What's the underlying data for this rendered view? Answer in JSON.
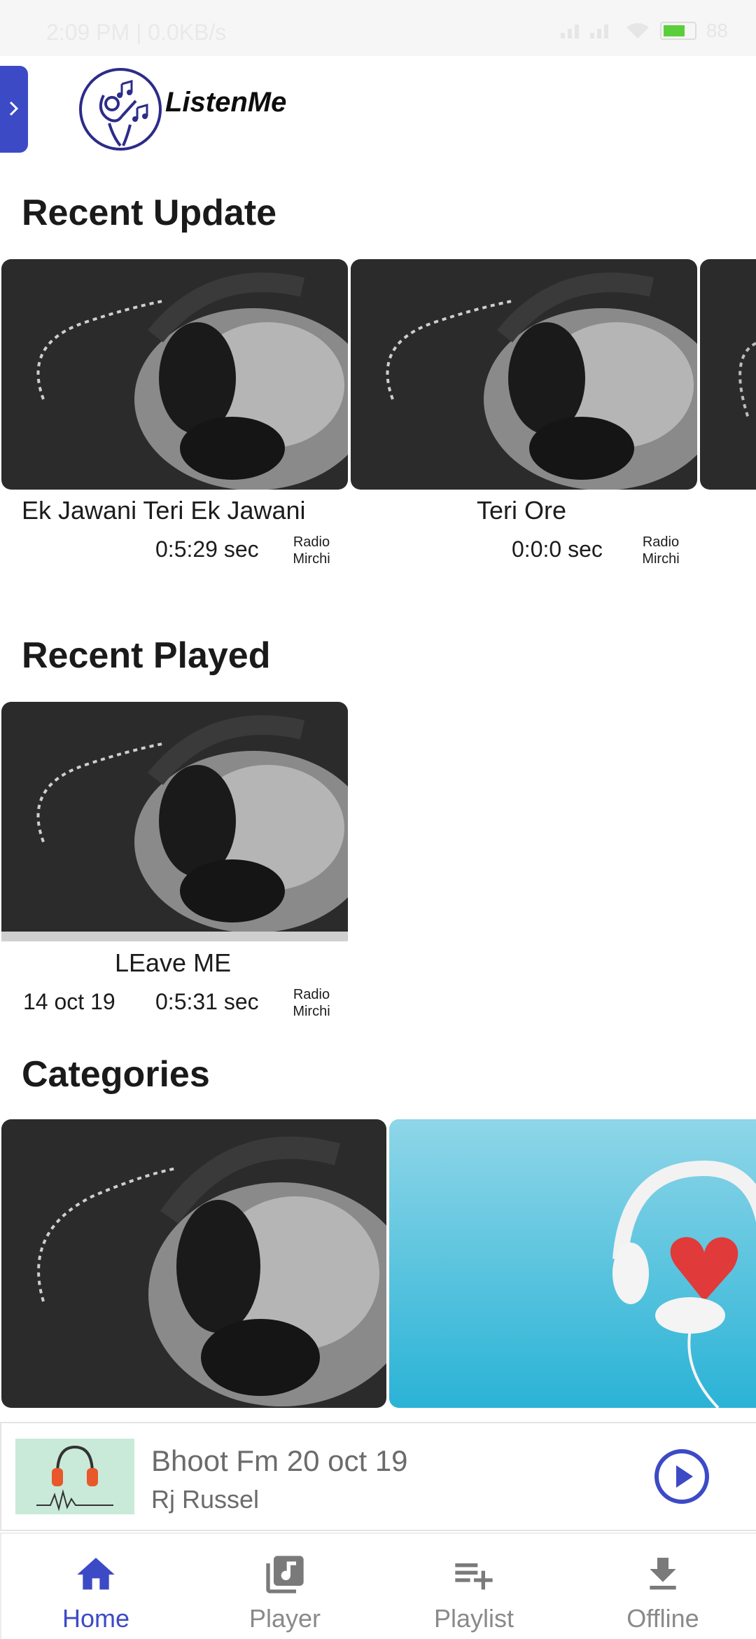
{
  "app": {
    "name": "ListenMe",
    "accent_color": "#3d4ac6"
  },
  "status_bar": {
    "time": "2:09 PM | 0.0KB/s",
    "battery": "88"
  },
  "sections": {
    "recent_update": {
      "title": "Recent Update",
      "items": [
        {
          "title": "Ek Jawani Teri Ek Jawani",
          "duration": "0:5:29 sec",
          "station_line1": "Radio",
          "station_line2": "Mirchi"
        },
        {
          "title": "Teri Ore",
          "duration": "0:0:0 sec",
          "station_line1": "Radio",
          "station_line2": "Mirchi"
        }
      ]
    },
    "recent_played": {
      "title": "Recent Played",
      "items": [
        {
          "title": "LEave ME",
          "date": "14 oct 19",
          "duration": "0:5:31 sec",
          "station_line1": "Radio",
          "station_line2": "Mirchi",
          "progress": 1.0
        }
      ]
    },
    "categories": {
      "title": "Categories"
    }
  },
  "mini_player": {
    "title": "Bhoot Fm 20 oct 19",
    "subtitle": "Rj Russel",
    "play_icon": "play-circle-icon"
  },
  "bottom_nav": {
    "items": [
      {
        "label": "Home",
        "icon": "home-icon",
        "active": true
      },
      {
        "label": "Player",
        "icon": "music-library-icon",
        "active": false
      },
      {
        "label": "Playlist",
        "icon": "playlist-add-icon",
        "active": false
      },
      {
        "label": "Offline",
        "icon": "download-icon",
        "active": false
      }
    ]
  }
}
